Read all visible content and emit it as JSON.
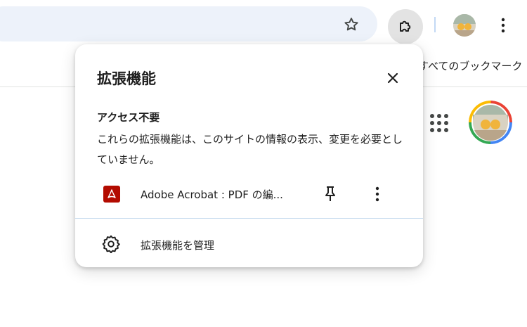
{
  "toolbar": {
    "icons": [
      "star-icon",
      "puzzle-icon",
      "avatar",
      "kebab-menu-icon"
    ]
  },
  "bookmark_bar": {
    "all_bookmarks_label": "すべてのブックマーク"
  },
  "colors": {
    "omnibox": "#edf2fa",
    "accent_divider": "#c2d8f4",
    "acrobat_red": "#b30b00"
  },
  "extensions_popup": {
    "title": "拡張機能",
    "section": {
      "heading": "アクセス不要",
      "description": "これらの拡張機能は、このサイトの情報の表示、変更を必要としていません。"
    },
    "extensions": [
      {
        "name": "Adobe Acrobat : PDF の編...",
        "icon": "acrobat-pdf-icon"
      }
    ],
    "manage_label": "拡張機能を管理"
  }
}
